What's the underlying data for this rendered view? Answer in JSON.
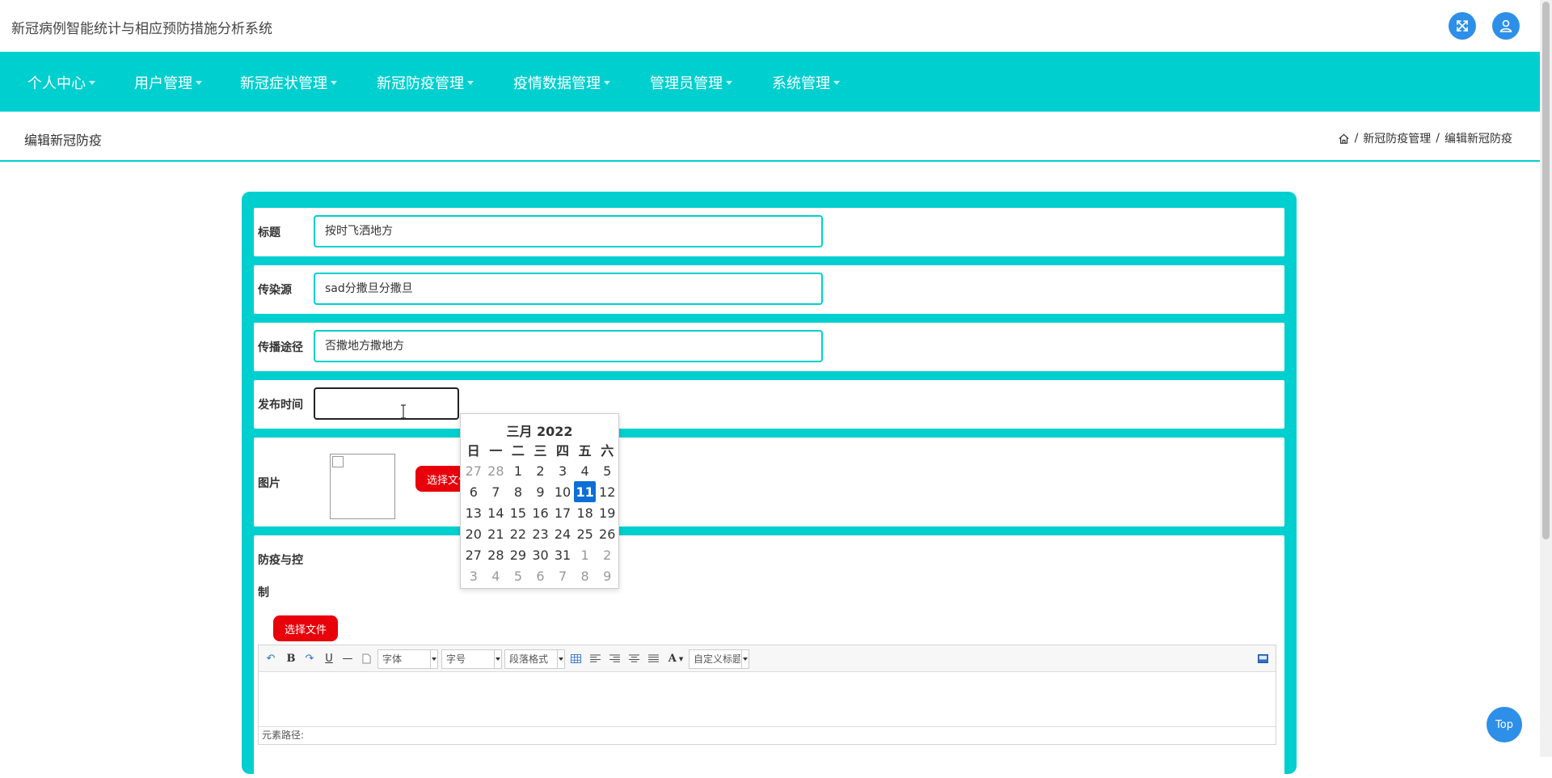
{
  "app_title": "新冠病例智能统计与相应预防措施分析系统",
  "header_icons": [
    "fullscreen-icon",
    "user-icon"
  ],
  "nav": [
    {
      "label": "个人中心"
    },
    {
      "label": "用户管理"
    },
    {
      "label": "新冠症状管理"
    },
    {
      "label": "新冠防疫管理"
    },
    {
      "label": "疫情数据管理"
    },
    {
      "label": "管理员管理"
    },
    {
      "label": "系统管理"
    }
  ],
  "page_title": "编辑新冠防疫",
  "breadcrumb": {
    "sep1": "/",
    "item1": "新冠防疫管理",
    "sep2": "/",
    "item2": "编辑新冠防疫"
  },
  "form": {
    "title_label": "标题",
    "title_value": "按时飞洒地方",
    "source_label": "传染源",
    "source_value": "sad分撒旦分撒旦",
    "route_label": "传播途径",
    "route_value": "否撒地方撒地方",
    "date_label": "发布时间",
    "date_value": "",
    "image_label": "图片",
    "image_button": "选择文件",
    "prevention_label_1": "防疫与控",
    "prevention_label_2": "制",
    "prevention_button": "选择文件"
  },
  "editor": {
    "font_select": "字体",
    "size_select": "字号",
    "para_select": "段落格式",
    "custom_title_select": "自定义标题",
    "statusbar": "元素路径:"
  },
  "calendar": {
    "header": "三月 2022",
    "weekdays": [
      "日",
      "一",
      "二",
      "三",
      "四",
      "五",
      "六"
    ],
    "weeks": [
      [
        "27",
        "28",
        "1",
        "2",
        "3",
        "4",
        "5"
      ],
      [
        "6",
        "7",
        "8",
        "9",
        "10",
        "11",
        "12"
      ],
      [
        "13",
        "14",
        "15",
        "16",
        "17",
        "18",
        "19"
      ],
      [
        "20",
        "21",
        "22",
        "23",
        "24",
        "25",
        "26"
      ],
      [
        "27",
        "28",
        "29",
        "30",
        "31",
        "1",
        "2"
      ],
      [
        "3",
        "4",
        "5",
        "6",
        "7",
        "8",
        "9"
      ]
    ],
    "selected": "11"
  },
  "top_button": "Top",
  "colors": {
    "accent": "#00cfcf",
    "blue": "#2e8fe8",
    "red": "#e8000a",
    "today": "#0d6fd6"
  }
}
